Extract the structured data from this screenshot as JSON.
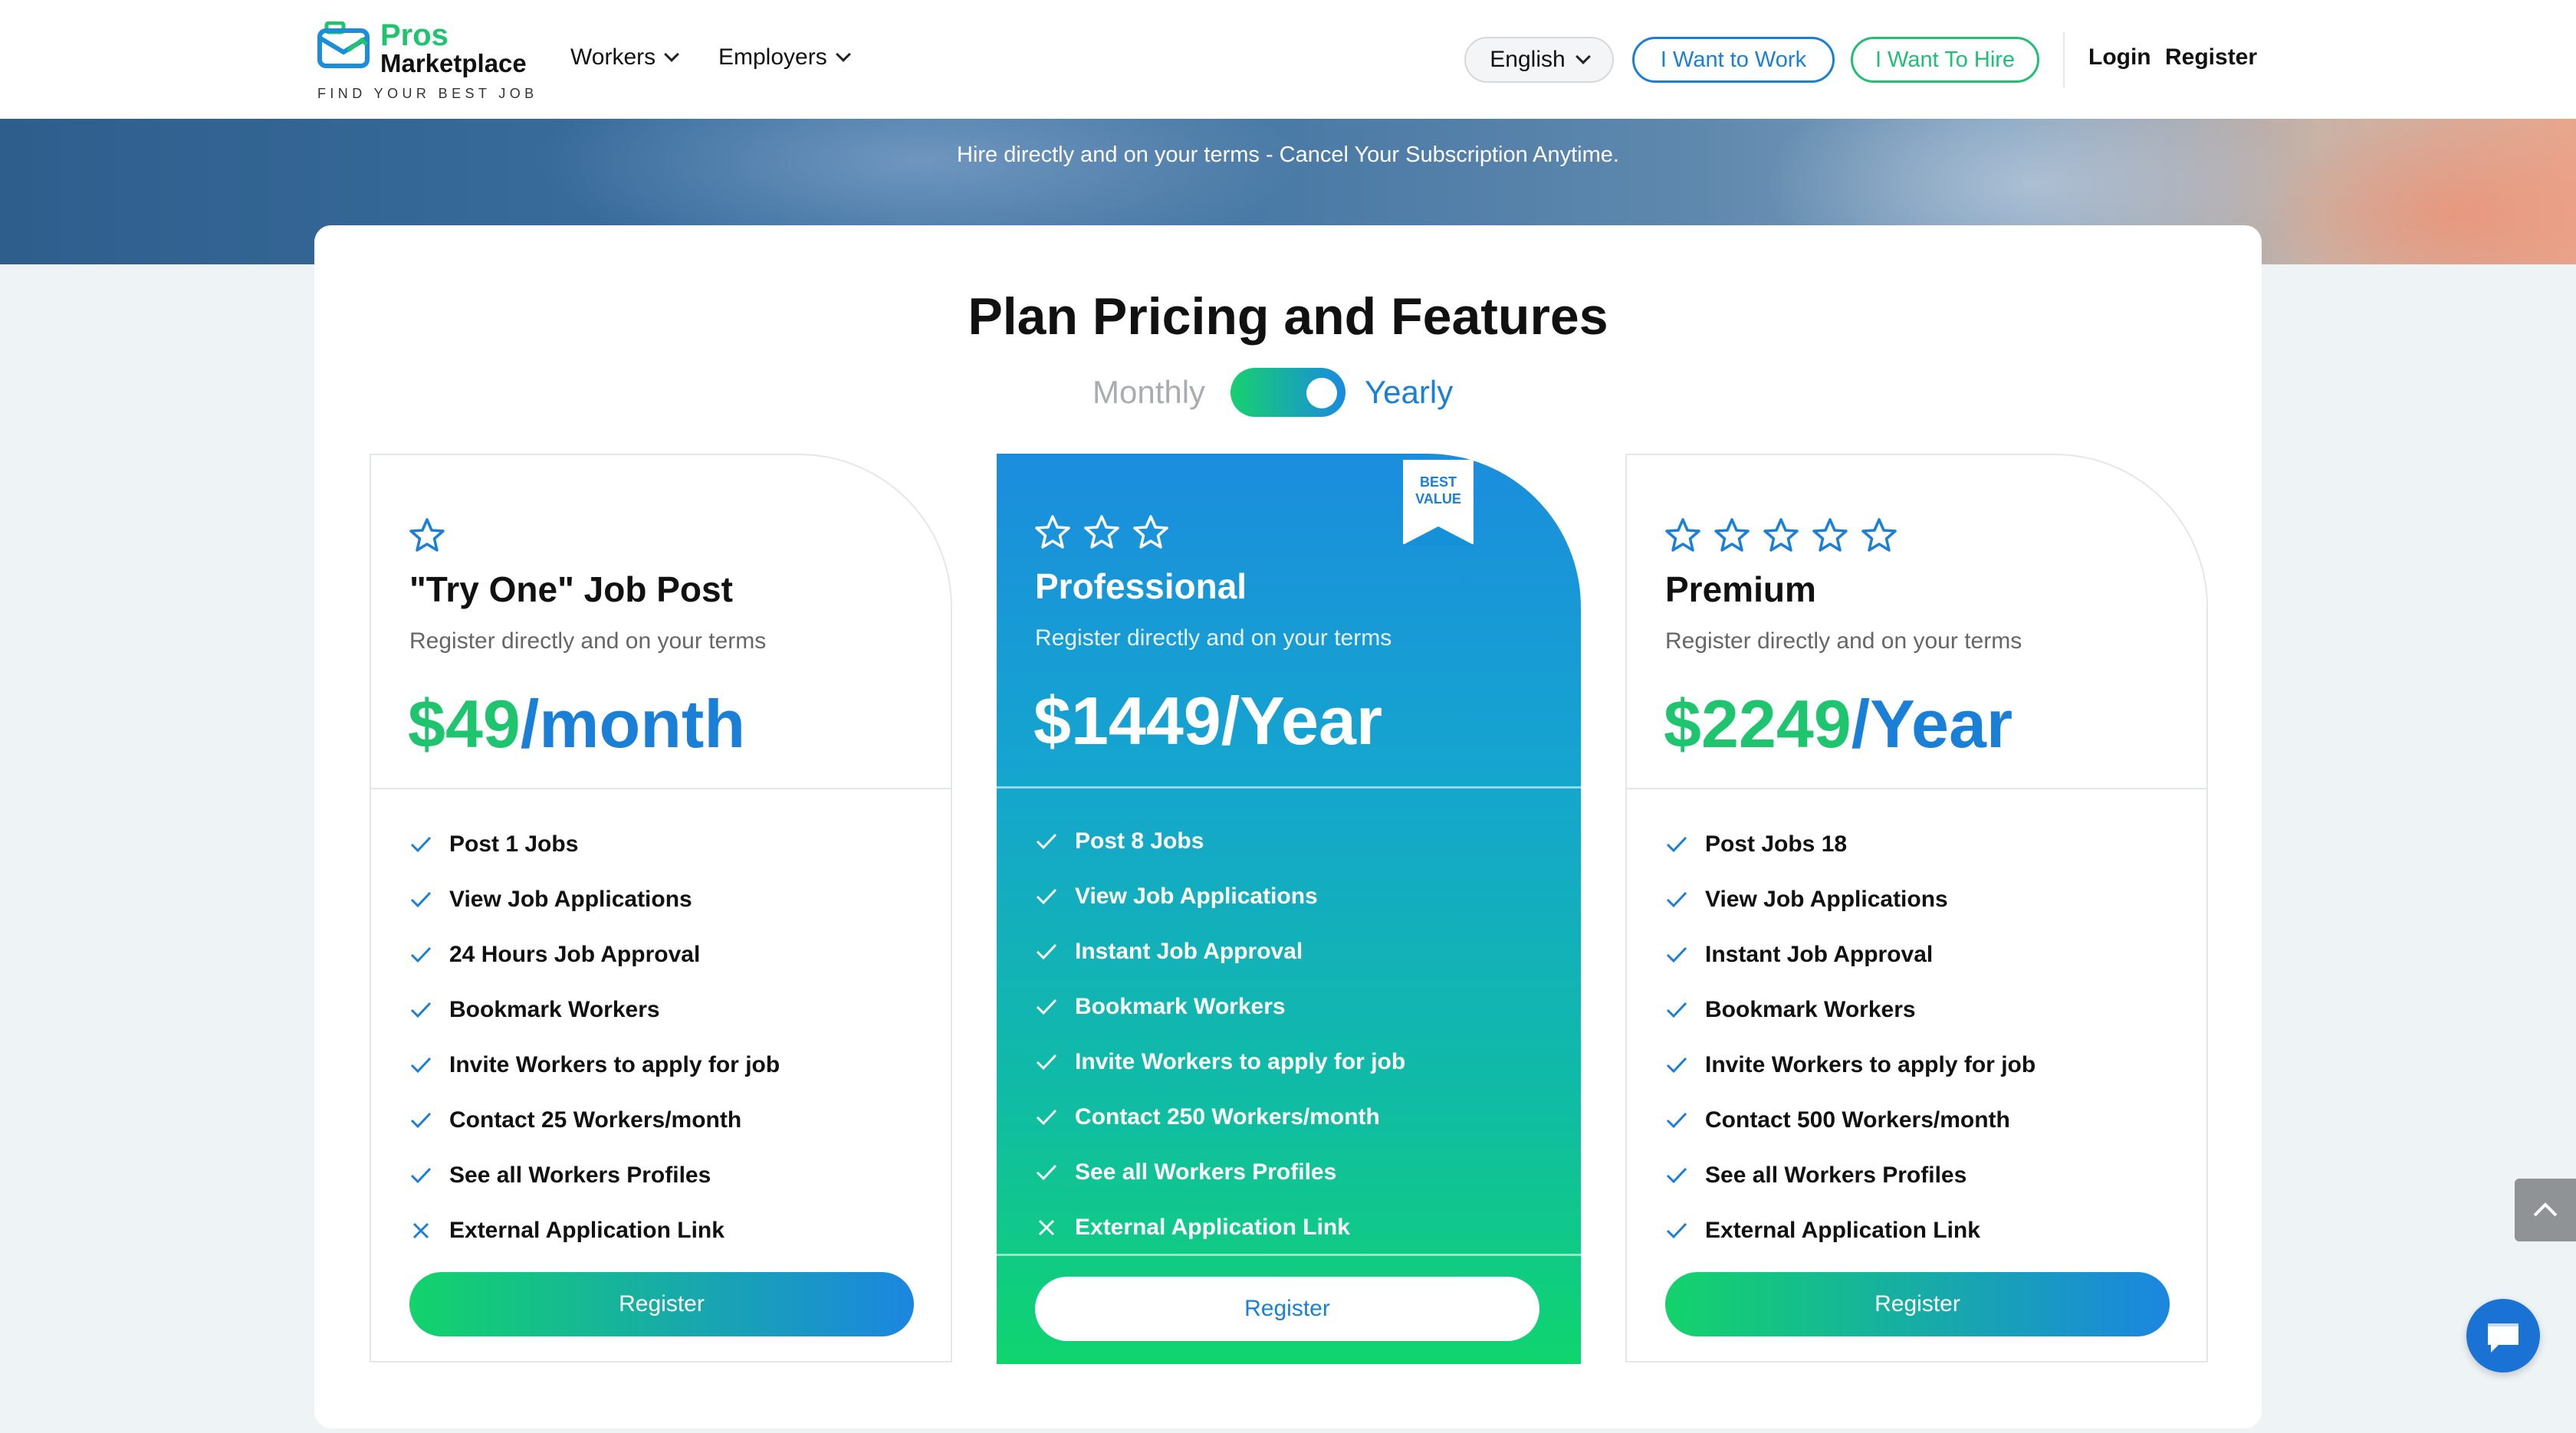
{
  "hero": {
    "subtitle": "Hire directly and on your terms - Cancel Your Subscription Anytime."
  },
  "header": {
    "logo_line1": "Pros",
    "logo_line2": "Marketplace",
    "logo_tagline": "FIND YOUR BEST JOB",
    "nav": [
      {
        "label": "Workers"
      },
      {
        "label": "Employers"
      }
    ],
    "language": "English",
    "want_work": "I Want to Work",
    "want_hire": "I Want To Hire",
    "login": "Login",
    "register": "Register"
  },
  "pricing": {
    "title": "Plan Pricing and Features",
    "toggle": {
      "monthly": "Monthly",
      "yearly": "Yearly",
      "selected": "Yearly"
    },
    "plans": [
      {
        "stars": 1,
        "name": "\"Try One\" Job Post",
        "desc": "Register directly and on your terms",
        "price": "$49",
        "period": "/month",
        "features": [
          {
            "label": "Post 1 Jobs",
            "included": true
          },
          {
            "label": "View Job Applications",
            "included": true
          },
          {
            "label": "24 Hours Job Approval",
            "included": true
          },
          {
            "label": "Bookmark Workers",
            "included": true
          },
          {
            "label": "Invite Workers to apply for job",
            "included": true
          },
          {
            "label": "Contact 25 Workers/month",
            "included": true
          },
          {
            "label": "See all Workers Profiles",
            "included": true
          },
          {
            "label": "External Application Link",
            "included": false
          }
        ],
        "button": "Register"
      },
      {
        "stars": 3,
        "badge": "BEST VALUE",
        "name": "Professional",
        "desc": "Register directly and on your terms",
        "price": "$1449",
        "period": "/Year",
        "features": [
          {
            "label": "Post 8 Jobs",
            "included": true
          },
          {
            "label": "View Job Applications",
            "included": true
          },
          {
            "label": "Instant Job Approval",
            "included": true
          },
          {
            "label": "Bookmark Workers",
            "included": true
          },
          {
            "label": "Invite Workers to apply for job",
            "included": true
          },
          {
            "label": "Contact 250 Workers/month",
            "included": true
          },
          {
            "label": "See all Workers Profiles",
            "included": true
          },
          {
            "label": "External Application Link",
            "included": false
          }
        ],
        "button": "Register"
      },
      {
        "stars": 5,
        "name": "Premium",
        "desc": "Register directly and on your terms",
        "price": "$2249",
        "period": "/Year",
        "features": [
          {
            "label": "Post Jobs 18",
            "included": true
          },
          {
            "label": "View Job Applications",
            "included": true
          },
          {
            "label": "Instant Job Approval",
            "included": true
          },
          {
            "label": "Bookmark Workers",
            "included": true
          },
          {
            "label": "Invite Workers to apply for job",
            "included": true
          },
          {
            "label": "Contact 500 Workers/month",
            "included": true
          },
          {
            "label": "See all Workers Profiles",
            "included": true
          },
          {
            "label": "External Application Link",
            "included": true
          }
        ],
        "button": "Register"
      }
    ]
  },
  "colors": {
    "green": "#1fc46f",
    "blue": "#1a7fd6"
  },
  "icons": {
    "scroll_top": "chevron-up-icon",
    "chat": "chat-icon"
  }
}
